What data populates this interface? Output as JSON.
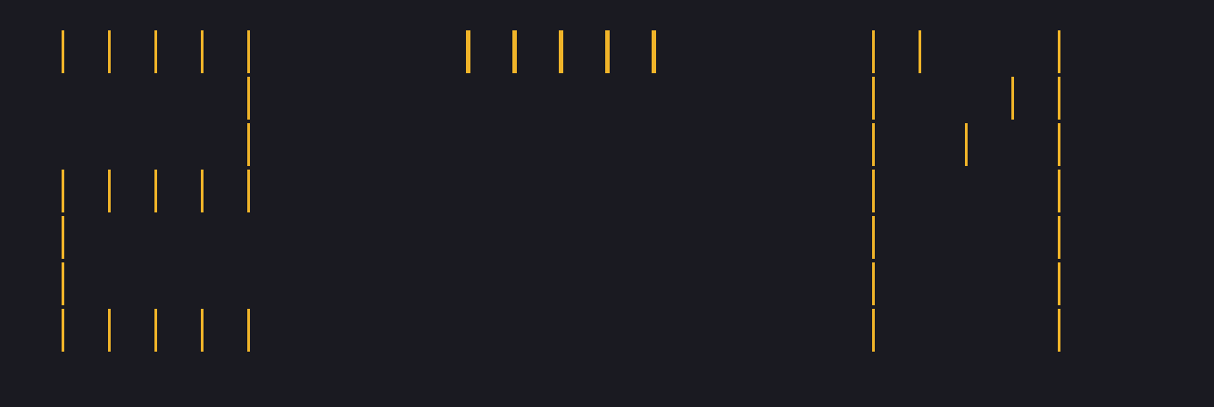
{
  "colors": {
    "background": "#1a1a21",
    "bar": "#f0b429"
  },
  "glyphs": [
    {
      "name": "glyph-e",
      "pattern": [
        "11111",
        "00001",
        "00001",
        "11111",
        "10000",
        "10000",
        "11111"
      ]
    },
    {
      "name": "glyph-dash",
      "pattern": [
        "11111"
      ]
    },
    {
      "name": "glyph-m",
      "pattern": [
        "11001",
        "10011",
        "10101",
        "10001",
        "10001",
        "10001",
        "10001"
      ]
    }
  ]
}
